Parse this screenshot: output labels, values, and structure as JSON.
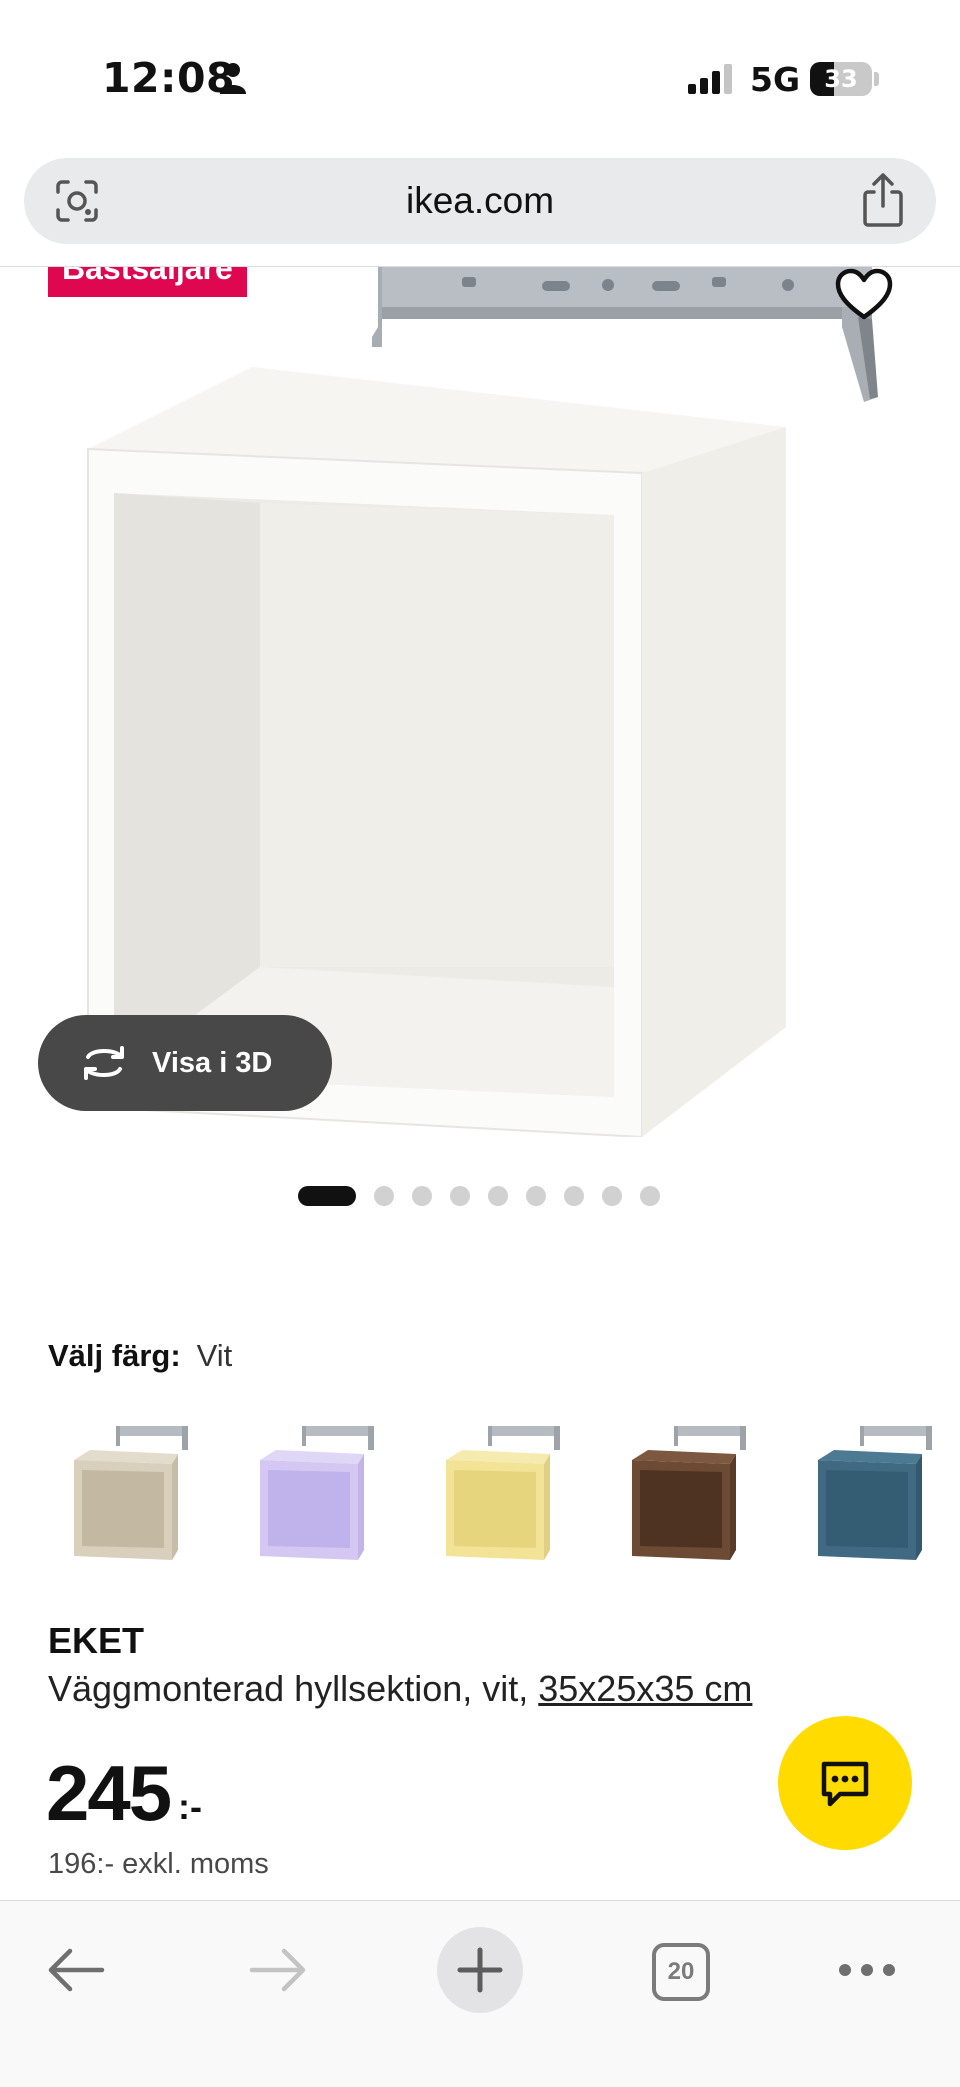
{
  "status_bar": {
    "time": "12:08",
    "network": "5G",
    "battery": "33"
  },
  "browser": {
    "url": "ikea.com",
    "open_tabs": "20"
  },
  "product": {
    "badge": "Bästsäljare",
    "view_3d_label": "Visa i 3D",
    "image_count": 9,
    "active_image": 1,
    "color_label": "Välj färg:",
    "color_value": "Vit",
    "name": "EKET",
    "description": "Väggmonterad hyllsektion, vit, ",
    "size": "35x25x35 cm",
    "price": "245",
    "price_suffix": ":-",
    "price_excl_vat": "196:- exkl. moms"
  },
  "swatches": [
    {
      "name": "swatch-beige",
      "color": "#d8cfbc"
    },
    {
      "name": "swatch-lilac",
      "color": "#d4c8f2"
    },
    {
      "name": "swatch-yellow",
      "color": "#f2e397"
    },
    {
      "name": "swatch-walnut",
      "color": "#6d4a33"
    },
    {
      "name": "swatch-blue",
      "color": "#3f6a82"
    }
  ],
  "colors": {
    "badge": "#e00751",
    "chat_button": "#ffdb00",
    "view3d_button": "#484848"
  }
}
